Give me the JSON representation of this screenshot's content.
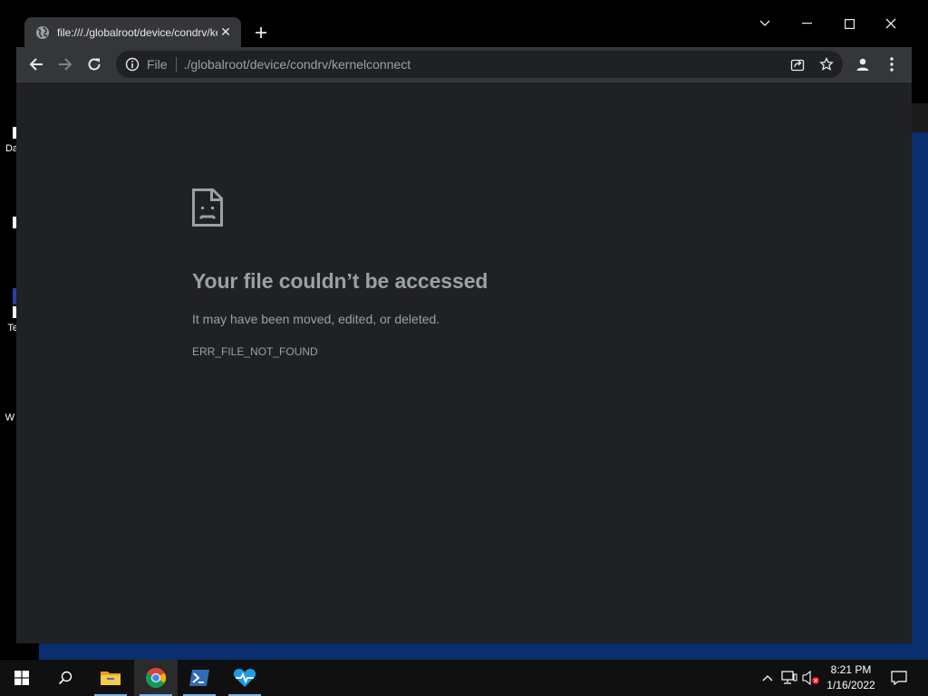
{
  "desktop": {
    "icon_labels": [
      "Da",
      "Te",
      "W"
    ]
  },
  "browser": {
    "tab": {
      "title": "file:///./globalroot/device/condrv/kernelconnect",
      "close_glyph": "✕"
    },
    "omnibox": {
      "scheme_label": "File",
      "url": "./globalroot/device/condrv/kernelconnect"
    },
    "icons": [
      "globe-icon",
      "new-tab-icon",
      "tab-search-icon",
      "minimize-icon",
      "maximize-icon",
      "close-icon",
      "back-icon",
      "forward-icon",
      "reload-icon",
      "info-icon",
      "share-icon",
      "bookmark-star-icon",
      "profile-icon",
      "menu-icon"
    ]
  },
  "error_page": {
    "title": "Your file couldn’t be accessed",
    "message": "It may have been moved, edited, or deleted.",
    "code": "ERR_FILE_NOT_FOUND",
    "icon": "sad-file-icon"
  },
  "taskbar": {
    "items": [
      "start-icon",
      "search-icon",
      "file-explorer-icon",
      "chrome-icon",
      "powershell-icon",
      "health-monitor-icon"
    ],
    "active_item": "chrome-icon",
    "tray_icons": [
      "chevron-up-icon",
      "network-icon",
      "volume-muted-icon",
      "notification-icon"
    ],
    "time": "8:21 PM",
    "date": "1/16/2022"
  },
  "colors": {
    "page_bg": "#202124",
    "toolbar_bg": "#35363a",
    "text_secondary": "#9aa0a6",
    "taskbar_bg": "#101010",
    "desktop_blue": "#0a2e6e"
  }
}
